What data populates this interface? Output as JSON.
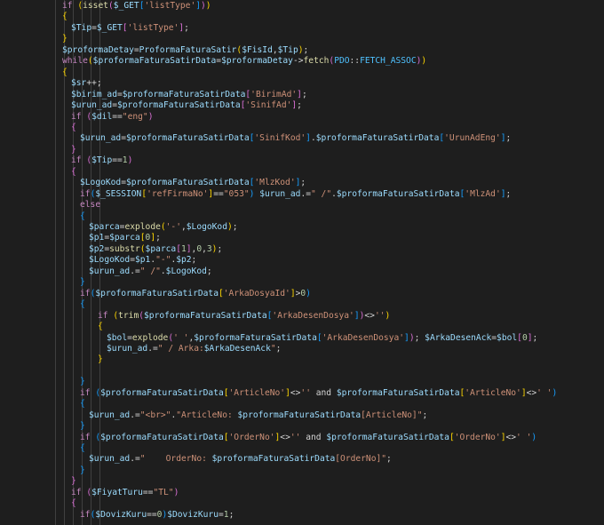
{
  "colors": {
    "background": "#1e1e1e",
    "keyword": "#c586c0",
    "variable": "#9cdcfe",
    "function": "#dcdcaa",
    "string": "#ce9178",
    "number": "#b5cea8",
    "operator": "#d4d4d4",
    "bracket_level1": "#ffd700",
    "bracket_level2": "#da70d6",
    "bracket_level3": "#179fff",
    "constant": "#4fc1ff"
  },
  "code_lines": [
    {
      "indent": 0,
      "tokens": [
        [
          "kw",
          "if"
        ],
        [
          "op",
          " "
        ],
        [
          "b1",
          "("
        ],
        [
          "fn",
          "isset"
        ],
        [
          "b2",
          "("
        ],
        [
          "var",
          "$_GET"
        ],
        [
          "b3",
          "["
        ],
        [
          "str",
          "'listType'"
        ],
        [
          "b3",
          "]"
        ],
        [
          "b2",
          ")"
        ],
        [
          "b1",
          ")"
        ]
      ]
    },
    {
      "indent": 0,
      "tokens": [
        [
          "b1",
          "{"
        ]
      ]
    },
    {
      "indent": 1,
      "tokens": [
        [
          "var",
          "$Tip"
        ],
        [
          "op",
          "="
        ],
        [
          "var",
          "$_GET"
        ],
        [
          "b2",
          "["
        ],
        [
          "str",
          "'listType'"
        ],
        [
          "b2",
          "]"
        ],
        [
          "op",
          ";"
        ]
      ]
    },
    {
      "indent": 0,
      "tokens": [
        [
          "b1",
          "}"
        ]
      ]
    },
    {
      "indent": 0,
      "tokens": [
        [
          "var",
          "$proformaDetay"
        ],
        [
          "op",
          "="
        ],
        [
          "var",
          "ProformaFaturaSatir"
        ],
        [
          "b1",
          "("
        ],
        [
          "var",
          "$FisId"
        ],
        [
          "op",
          ","
        ],
        [
          "var",
          "$Tip"
        ],
        [
          "b1",
          ")"
        ],
        [
          "op",
          ";"
        ]
      ]
    },
    {
      "indent": 0,
      "tokens": [
        [
          "kw",
          "while"
        ],
        [
          "b1",
          "("
        ],
        [
          "var",
          "$proformaFaturaSatirData"
        ],
        [
          "op",
          "="
        ],
        [
          "var",
          "$proformaDetay"
        ],
        [
          "op",
          "->"
        ],
        [
          "fn",
          "fetch"
        ],
        [
          "b2",
          "("
        ],
        [
          "const",
          "PDO"
        ],
        [
          "op",
          "::"
        ],
        [
          "const",
          "FETCH_ASSOC"
        ],
        [
          "b2",
          ")"
        ],
        [
          "b1",
          ")"
        ]
      ]
    },
    {
      "indent": 0,
      "tokens": [
        [
          "b1",
          "{"
        ]
      ]
    },
    {
      "indent": 1,
      "tokens": [
        [
          "var",
          "$sr"
        ],
        [
          "op",
          "++;"
        ]
      ]
    },
    {
      "indent": 1,
      "tokens": [
        [
          "var",
          "$birim_ad"
        ],
        [
          "op",
          "="
        ],
        [
          "var",
          "$proformaFaturaSatirData"
        ],
        [
          "b2",
          "["
        ],
        [
          "str",
          "'BirimAd'"
        ],
        [
          "b2",
          "]"
        ],
        [
          "op",
          ";"
        ]
      ]
    },
    {
      "indent": 1,
      "tokens": [
        [
          "var",
          "$urun_ad"
        ],
        [
          "op",
          "="
        ],
        [
          "var",
          "$proformaFaturaSatirData"
        ],
        [
          "b2",
          "["
        ],
        [
          "str",
          "'SinifAd'"
        ],
        [
          "b2",
          "]"
        ],
        [
          "op",
          ";"
        ]
      ]
    },
    {
      "indent": 1,
      "tokens": [
        [
          "kw",
          "if"
        ],
        [
          "op",
          " "
        ],
        [
          "b2",
          "("
        ],
        [
          "var",
          "$dil"
        ],
        [
          "op",
          "=="
        ],
        [
          "str",
          "\"eng\""
        ],
        [
          "b2",
          ")"
        ]
      ]
    },
    {
      "indent": 1,
      "tokens": [
        [
          "b2",
          "{"
        ]
      ]
    },
    {
      "indent": 2,
      "tokens": [
        [
          "var",
          "$urun_ad"
        ],
        [
          "op",
          "="
        ],
        [
          "var",
          "$proformaFaturaSatirData"
        ],
        [
          "b3",
          "["
        ],
        [
          "str",
          "'SinifKod'"
        ],
        [
          "b3",
          "]"
        ],
        [
          "op",
          "."
        ],
        [
          "var",
          "$proformaFaturaSatirData"
        ],
        [
          "b3",
          "["
        ],
        [
          "str",
          "'UrunAdEng'"
        ],
        [
          "b3",
          "]"
        ],
        [
          "op",
          ";"
        ]
      ]
    },
    {
      "indent": 1,
      "tokens": [
        [
          "b2",
          "}"
        ]
      ]
    },
    {
      "indent": 1,
      "tokens": [
        [
          "kw",
          "if"
        ],
        [
          "op",
          " "
        ],
        [
          "b2",
          "("
        ],
        [
          "var",
          "$Tip"
        ],
        [
          "op",
          "=="
        ],
        [
          "num",
          "1"
        ],
        [
          "b2",
          ")"
        ]
      ]
    },
    {
      "indent": 1,
      "tokens": [
        [
          "b2",
          "{"
        ]
      ]
    },
    {
      "indent": 2,
      "tokens": [
        [
          "var",
          "$LogoKod"
        ],
        [
          "op",
          "="
        ],
        [
          "var",
          "$proformaFaturaSatirData"
        ],
        [
          "b3",
          "["
        ],
        [
          "str",
          "'MlzKod'"
        ],
        [
          "b3",
          "]"
        ],
        [
          "op",
          ";"
        ]
      ]
    },
    {
      "indent": 2,
      "tokens": [
        [
          "kw",
          "if"
        ],
        [
          "b3",
          "("
        ],
        [
          "var",
          "$_SESSION"
        ],
        [
          "b1",
          "["
        ],
        [
          "str",
          "'refFirmaNo'"
        ],
        [
          "b1",
          "]"
        ],
        [
          "op",
          "=="
        ],
        [
          "str",
          "\"053\""
        ],
        [
          "b3",
          ")"
        ],
        [
          "op",
          " "
        ],
        [
          "var",
          "$urun_ad"
        ],
        [
          "op",
          ".="
        ],
        [
          "str",
          "\" /\""
        ],
        [
          "op",
          "."
        ],
        [
          "var",
          "$proformaFaturaSatirData"
        ],
        [
          "b3",
          "["
        ],
        [
          "str",
          "'MlzAd'"
        ],
        [
          "b3",
          "]"
        ],
        [
          "op",
          ";"
        ]
      ]
    },
    {
      "indent": 2,
      "tokens": [
        [
          "kw",
          "else"
        ]
      ]
    },
    {
      "indent": 2,
      "tokens": [
        [
          "b3",
          "{"
        ]
      ]
    },
    {
      "indent": 3,
      "tokens": [
        [
          "var",
          "$parca"
        ],
        [
          "op",
          "="
        ],
        [
          "fn",
          "explode"
        ],
        [
          "b1",
          "("
        ],
        [
          "str",
          "'-'"
        ],
        [
          "op",
          ","
        ],
        [
          "var",
          "$LogoKod"
        ],
        [
          "b1",
          ")"
        ],
        [
          "op",
          ";"
        ]
      ]
    },
    {
      "indent": 3,
      "tokens": [
        [
          "var",
          "$p1"
        ],
        [
          "op",
          "="
        ],
        [
          "var",
          "$parca"
        ],
        [
          "b1",
          "["
        ],
        [
          "num",
          "0"
        ],
        [
          "b1",
          "]"
        ],
        [
          "op",
          ";"
        ]
      ]
    },
    {
      "indent": 3,
      "tokens": [
        [
          "var",
          "$p2"
        ],
        [
          "op",
          "="
        ],
        [
          "fn",
          "substr"
        ],
        [
          "b1",
          "("
        ],
        [
          "var",
          "$parca"
        ],
        [
          "b2",
          "["
        ],
        [
          "num",
          "1"
        ],
        [
          "b2",
          "]"
        ],
        [
          "op",
          ","
        ],
        [
          "num",
          "0"
        ],
        [
          "op",
          ","
        ],
        [
          "num",
          "3"
        ],
        [
          "b1",
          ")"
        ],
        [
          "op",
          ";"
        ]
      ]
    },
    {
      "indent": 3,
      "tokens": [
        [
          "var",
          "$LogoKod"
        ],
        [
          "op",
          "="
        ],
        [
          "var",
          "$p1"
        ],
        [
          "op",
          "."
        ],
        [
          "str",
          "\"-\""
        ],
        [
          "op",
          "."
        ],
        [
          "var",
          "$p2"
        ],
        [
          "op",
          ";"
        ]
      ]
    },
    {
      "indent": 3,
      "tokens": [
        [
          "var",
          "$urun_ad"
        ],
        [
          "op",
          ".="
        ],
        [
          "str",
          "\" /\""
        ],
        [
          "op",
          "."
        ],
        [
          "var",
          "$LogoKod"
        ],
        [
          "op",
          ";"
        ]
      ]
    },
    {
      "indent": 2,
      "tokens": [
        [
          "b3",
          "}"
        ]
      ]
    },
    {
      "indent": 2,
      "tokens": [
        [
          "kw",
          "if"
        ],
        [
          "b3",
          "("
        ],
        [
          "var",
          "$proformaFaturaSatirData"
        ],
        [
          "b1",
          "["
        ],
        [
          "str",
          "'ArkaDosyaId'"
        ],
        [
          "b1",
          "]"
        ],
        [
          "op",
          ">"
        ],
        [
          "num",
          "0"
        ],
        [
          "b3",
          ")"
        ]
      ]
    },
    {
      "indent": 2,
      "tokens": [
        [
          "b3",
          "{"
        ]
      ]
    },
    {
      "indent": 4,
      "tokens": [
        [
          "kw",
          "if"
        ],
        [
          "op",
          " "
        ],
        [
          "b1",
          "("
        ],
        [
          "fn",
          "trim"
        ],
        [
          "b2",
          "("
        ],
        [
          "var",
          "$proformaFaturaSatirData"
        ],
        [
          "b3",
          "["
        ],
        [
          "str",
          "'ArkaDesenDosya'"
        ],
        [
          "b3",
          "]"
        ],
        [
          "b2",
          ")"
        ],
        [
          "op",
          "<>"
        ],
        [
          "str",
          "''"
        ],
        [
          "b1",
          ")"
        ]
      ]
    },
    {
      "indent": 4,
      "tokens": [
        [
          "b1",
          "{"
        ]
      ]
    },
    {
      "indent": 5,
      "tokens": [
        [
          "var",
          "$bol"
        ],
        [
          "op",
          "="
        ],
        [
          "fn",
          "explode"
        ],
        [
          "b2",
          "("
        ],
        [
          "str",
          "' '"
        ],
        [
          "op",
          ","
        ],
        [
          "var",
          "$proformaFaturaSatirData"
        ],
        [
          "b3",
          "["
        ],
        [
          "str",
          "'ArkaDesenDosya'"
        ],
        [
          "b3",
          "]"
        ],
        [
          "b2",
          ")"
        ],
        [
          "op",
          "; "
        ],
        [
          "var",
          "$ArkaDesenAck"
        ],
        [
          "op",
          "="
        ],
        [
          "var",
          "$bol"
        ],
        [
          "b2",
          "["
        ],
        [
          "num",
          "0"
        ],
        [
          "b2",
          "]"
        ],
        [
          "op",
          ";"
        ]
      ]
    },
    {
      "indent": 5,
      "tokens": [
        [
          "var",
          "$urun_ad"
        ],
        [
          "op",
          ".="
        ],
        [
          "str",
          "\" / Arka:"
        ],
        [
          "var",
          "$ArkaDesenAck"
        ],
        [
          "str",
          "\""
        ],
        [
          "op",
          ";"
        ]
      ]
    },
    {
      "indent": 4,
      "tokens": [
        [
          "b1",
          "}"
        ]
      ]
    },
    {
      "indent": 2,
      "tokens": []
    },
    {
      "indent": 2,
      "tokens": [
        [
          "b3",
          "}"
        ]
      ]
    },
    {
      "indent": 2,
      "tokens": [
        [
          "kw",
          "if"
        ],
        [
          "op",
          " "
        ],
        [
          "b3",
          "("
        ],
        [
          "var",
          "$proformaFaturaSatirData"
        ],
        [
          "b1",
          "["
        ],
        [
          "str",
          "'ArticleNo'"
        ],
        [
          "b1",
          "]"
        ],
        [
          "op",
          "<>"
        ],
        [
          "str",
          "''"
        ],
        [
          "op",
          " and "
        ],
        [
          "var",
          "$proformaFaturaSatirData"
        ],
        [
          "b1",
          "["
        ],
        [
          "str",
          "'ArticleNo'"
        ],
        [
          "b1",
          "]"
        ],
        [
          "op",
          "<>"
        ],
        [
          "str",
          "' '"
        ],
        [
          "b3",
          ")"
        ]
      ]
    },
    {
      "indent": 2,
      "tokens": [
        [
          "b3",
          "{"
        ]
      ]
    },
    {
      "indent": 3,
      "tokens": [
        [
          "var",
          "$urun_ad"
        ],
        [
          "op",
          ".="
        ],
        [
          "str",
          "\"<br>\""
        ],
        [
          "op",
          "."
        ],
        [
          "str",
          "\"ArticleNo: "
        ],
        [
          "var",
          "$proformaFaturaSatirData"
        ],
        [
          "str",
          "[ArticleNo]\""
        ],
        [
          "op",
          ";"
        ]
      ]
    },
    {
      "indent": 2,
      "tokens": [
        [
          "b3",
          "}"
        ]
      ]
    },
    {
      "indent": 2,
      "tokens": [
        [
          "kw",
          "if"
        ],
        [
          "op",
          " "
        ],
        [
          "b3",
          "("
        ],
        [
          "var",
          "$proformaFaturaSatirData"
        ],
        [
          "b1",
          "["
        ],
        [
          "str",
          "'OrderNo'"
        ],
        [
          "b1",
          "]"
        ],
        [
          "op",
          "<>"
        ],
        [
          "str",
          "''"
        ],
        [
          "op",
          " and "
        ],
        [
          "var",
          "$proformaFaturaSatirData"
        ],
        [
          "b1",
          "["
        ],
        [
          "str",
          "'OrderNo'"
        ],
        [
          "b1",
          "]"
        ],
        [
          "op",
          "<>"
        ],
        [
          "str",
          "' '"
        ],
        [
          "b3",
          ")"
        ]
      ]
    },
    {
      "indent": 2,
      "tokens": [
        [
          "b3",
          "{"
        ]
      ]
    },
    {
      "indent": 3,
      "tokens": [
        [
          "var",
          "$urun_ad"
        ],
        [
          "op",
          ".="
        ],
        [
          "str",
          "\"    OrderNo: "
        ],
        [
          "var",
          "$proformaFaturaSatirData"
        ],
        [
          "str",
          "[OrderNo]\""
        ],
        [
          "op",
          ";"
        ]
      ]
    },
    {
      "indent": 2,
      "tokens": [
        [
          "b3",
          "}"
        ]
      ]
    },
    {
      "indent": 1,
      "tokens": [
        [
          "b2",
          "}"
        ]
      ]
    },
    {
      "indent": 1,
      "tokens": [
        [
          "kw",
          "if"
        ],
        [
          "op",
          " "
        ],
        [
          "b2",
          "("
        ],
        [
          "var",
          "$FiyatTuru"
        ],
        [
          "op",
          "=="
        ],
        [
          "str",
          "\"TL\""
        ],
        [
          "b2",
          ")"
        ]
      ]
    },
    {
      "indent": 1,
      "tokens": [
        [
          "b2",
          "{"
        ]
      ]
    },
    {
      "indent": 2,
      "tokens": [
        [
          "kw",
          "if"
        ],
        [
          "b3",
          "("
        ],
        [
          "var",
          "$DovizKuru"
        ],
        [
          "op",
          "=="
        ],
        [
          "num",
          "0"
        ],
        [
          "b3",
          ")"
        ],
        [
          "var",
          "$DovizKuru"
        ],
        [
          "op",
          "="
        ],
        [
          "num",
          "1"
        ],
        [
          "op",
          ";"
        ]
      ]
    }
  ]
}
